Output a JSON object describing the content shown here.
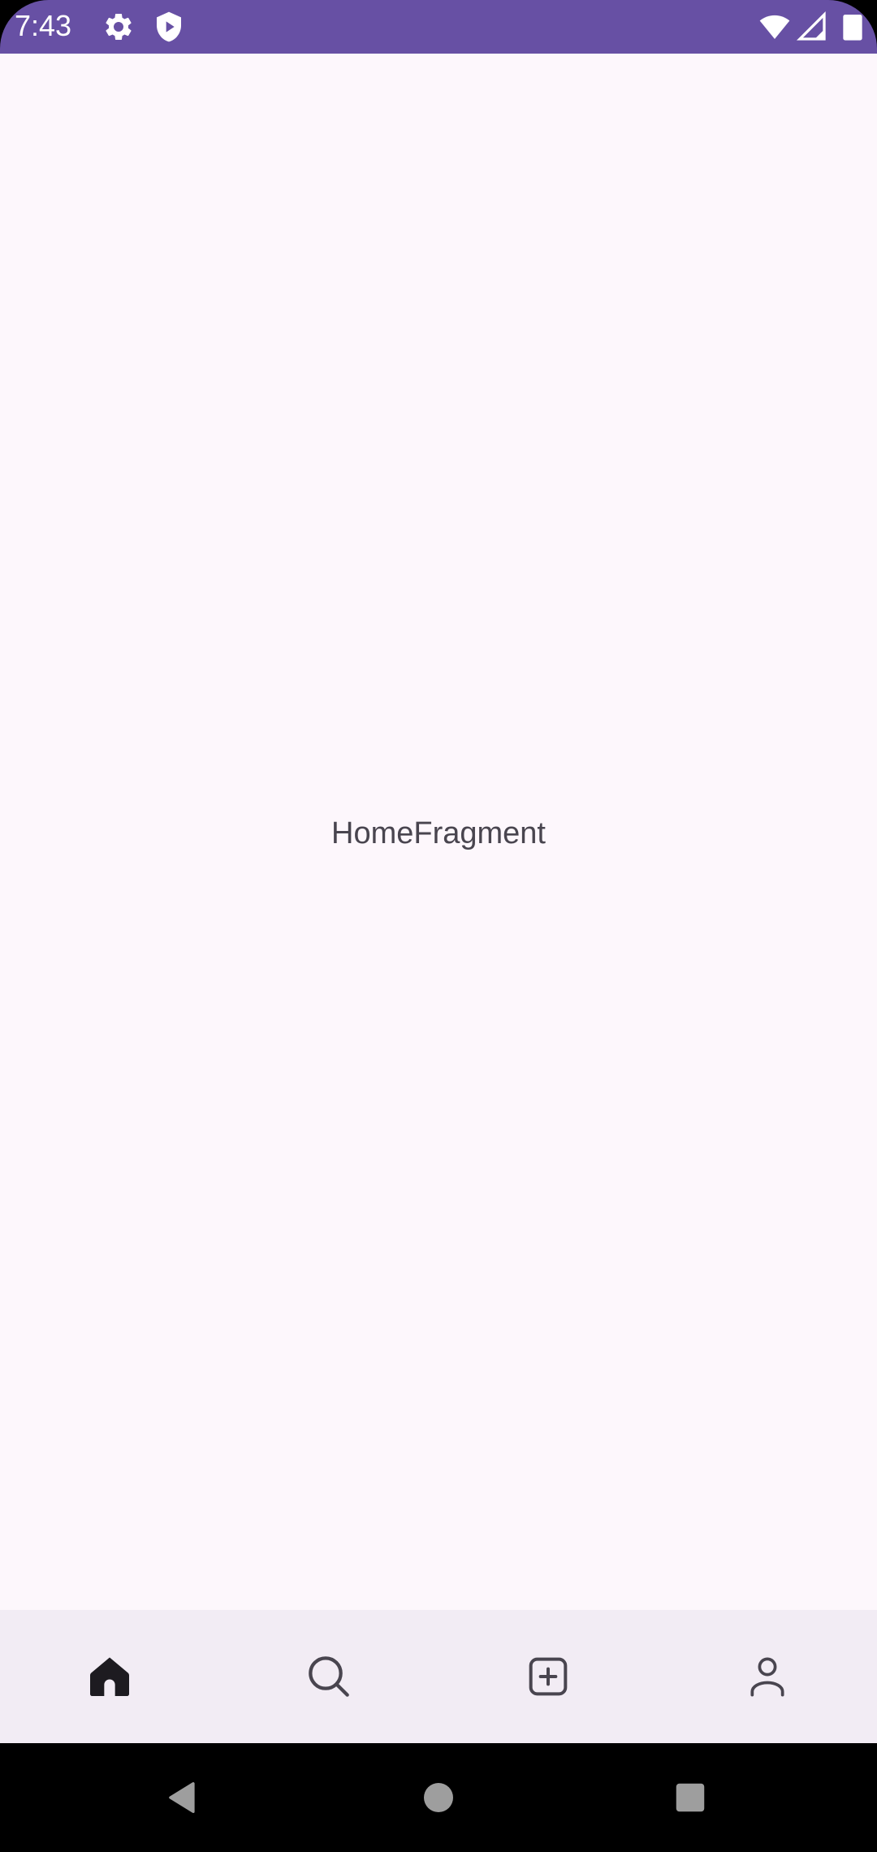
{
  "status_bar": {
    "time": "7:43",
    "background": "#6750A4",
    "left_icons": [
      "settings-gear-icon",
      "shield-play-icon"
    ],
    "right_icons": [
      "wifi-icon",
      "cell-signal-icon",
      "battery-icon"
    ]
  },
  "main": {
    "label": "HomeFragment",
    "background": "#FDF7FC",
    "text_color": "#49454F"
  },
  "bottom_nav": {
    "background": "#F2ECF4",
    "items": [
      {
        "icon": "home-icon",
        "selected": true
      },
      {
        "icon": "search-icon",
        "selected": false
      },
      {
        "icon": "add-box-icon",
        "selected": false
      },
      {
        "icon": "person-icon",
        "selected": false
      }
    ]
  },
  "system_nav": {
    "buttons": [
      "back-icon",
      "home-circle-icon",
      "recents-square-icon"
    ]
  }
}
